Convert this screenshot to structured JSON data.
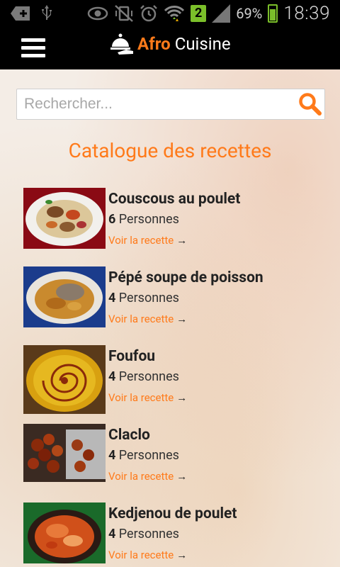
{
  "status_bar": {
    "battery_pct": "69%",
    "time": "18:39",
    "network_badge": "2"
  },
  "app_bar": {
    "brand_accent": "Afro",
    "brand_main": "Cuisine"
  },
  "search": {
    "placeholder": "Rechercher...",
    "value": ""
  },
  "page_title": "Catalogue des recettes",
  "recipes": [
    {
      "name": "Couscous au poulet",
      "count": "6",
      "people_label": "Personnes",
      "link": "Voir la recette",
      "arrow": "→"
    },
    {
      "name": "Pépé soupe de poisson",
      "count": "4",
      "people_label": "Personnes",
      "link": "Voir la recette",
      "arrow": "→"
    },
    {
      "name": "Foufou",
      "count": "4",
      "people_label": "Personnes",
      "link": "Voir la recette",
      "arrow": "→"
    },
    {
      "name": "Claclo",
      "count": "4",
      "people_label": "Personnes",
      "link": "Voir la recette",
      "arrow": "→"
    },
    {
      "name": "Kedjenou de poulet",
      "count": "4",
      "people_label": "Personnes",
      "link": "Voir la recette",
      "arrow": "→"
    }
  ],
  "colors": {
    "accent": "#ff7a1a",
    "bar": "#000000"
  }
}
